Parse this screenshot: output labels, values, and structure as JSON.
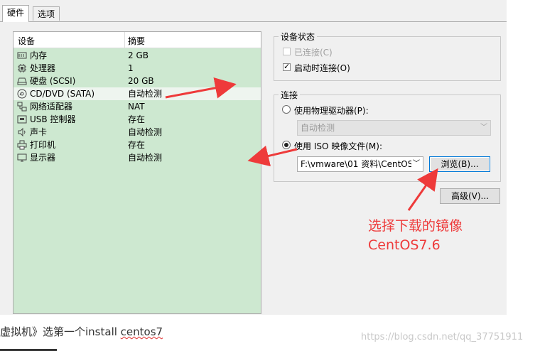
{
  "tabs": [
    {
      "label": "硬件",
      "active": true
    },
    {
      "label": "选项",
      "active": false
    }
  ],
  "device_list": {
    "columns": [
      "设备",
      "摘要"
    ],
    "rows": [
      {
        "icon": "memory-icon",
        "name": "内存",
        "summary": "2 GB"
      },
      {
        "icon": "cpu-icon",
        "name": "处理器",
        "summary": "1"
      },
      {
        "icon": "harddisk-icon",
        "name": "硬盘 (SCSI)",
        "summary": "20 GB"
      },
      {
        "icon": "cd-dvd-icon",
        "name": "CD/DVD (SATA)",
        "summary": "自动检测",
        "selected": true
      },
      {
        "icon": "network-adapter-icon",
        "name": "网络适配器",
        "summary": "NAT"
      },
      {
        "icon": "usb-controller-icon",
        "name": "USB 控制器",
        "summary": "存在"
      },
      {
        "icon": "sound-card-icon",
        "name": "声卡",
        "summary": "自动检测"
      },
      {
        "icon": "printer-icon",
        "name": "打印机",
        "summary": "存在"
      },
      {
        "icon": "display-icon",
        "name": "显示器",
        "summary": "自动检测"
      }
    ]
  },
  "device_status": {
    "title": "设备状态",
    "connected_label": "已连接(C)",
    "connected_checked": false,
    "connected_enabled": false,
    "connect_on_power_label": "启动时连接(O)",
    "connect_on_power_checked": true
  },
  "connection": {
    "title": "连接",
    "physical_drive_label": "使用物理驱动器(P):",
    "physical_drive_selected": false,
    "physical_drive_value": "自动检测",
    "iso_label": "使用 ISO 映像文件(M):",
    "iso_selected": true,
    "iso_path": "F:\\vmware\\01 资料\\CentOS",
    "browse_label": "浏览(B)...",
    "advanced_label": "高级(V)..."
  },
  "annotation": {
    "line1": "选择下载的镜像",
    "line2": "CentOS7.6",
    "color": "#ee3a3a"
  },
  "page_text": {
    "bottom_prefix": "虚拟机》选第一个install ",
    "bottom_link": "centos7"
  },
  "watermark": "https://blog.csdn.net/qq_37751911"
}
